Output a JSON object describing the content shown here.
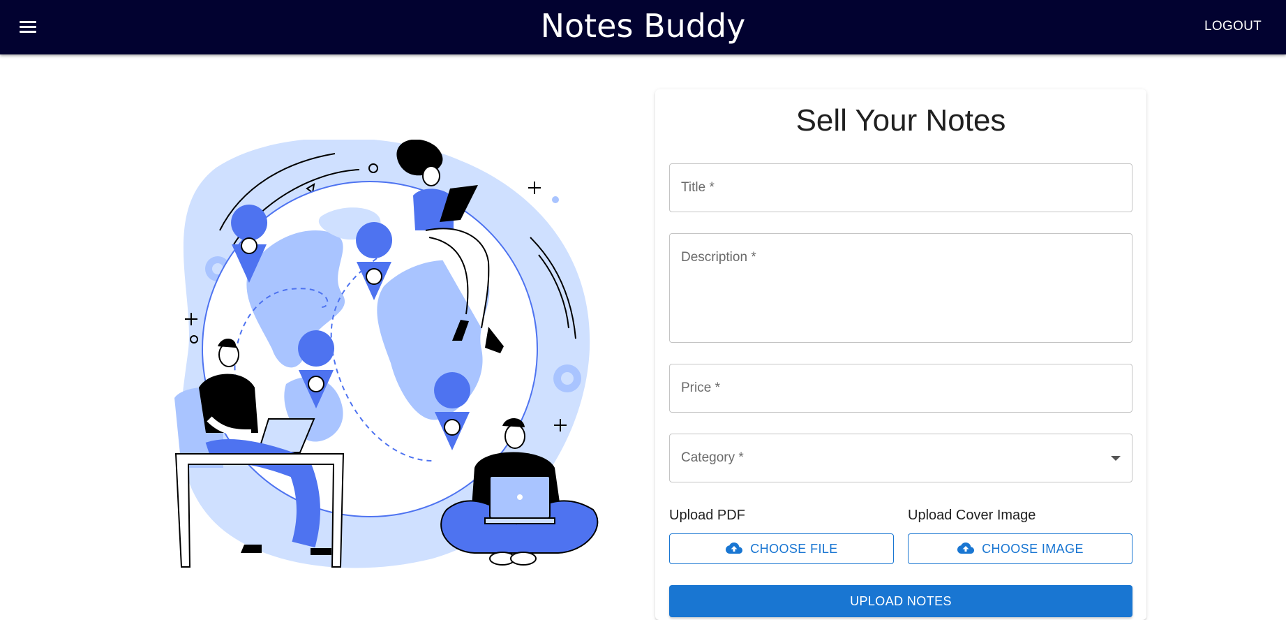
{
  "appbar": {
    "title": "Notes Buddy",
    "logout_label": "LOGOUT",
    "menu_icon": "hamburger-menu-icon",
    "background_color": "#020230"
  },
  "form": {
    "heading": "Sell Your Notes",
    "title_placeholder": "Title *",
    "description_placeholder": "Description *",
    "price_placeholder": "Price *",
    "category_placeholder": "Category *",
    "upload_pdf_label": "Upload PDF",
    "upload_cover_label": "Upload Cover Image",
    "choose_file_label": "CHOOSE FILE",
    "choose_image_label": "CHOOSE IMAGE",
    "submit_label": "UPLOAD NOTES",
    "upload_icon": "cloud-upload-icon",
    "accent_color": "#1976d2"
  },
  "illustration": {
    "name": "people-working-around-globe",
    "colors": [
      "#cfe0ff",
      "#a9c4ff",
      "#4e73f0",
      "#000000"
    ]
  }
}
